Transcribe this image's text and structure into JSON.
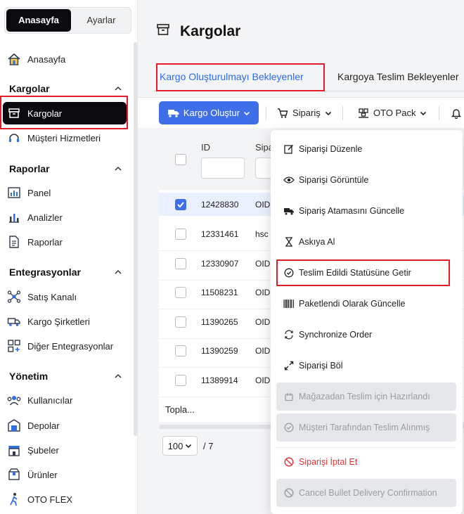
{
  "sidebar": {
    "toggle": {
      "active": "Anasayfa",
      "inactive": "Ayarlar"
    },
    "home": {
      "label": "Anasayfa"
    },
    "sections": [
      {
        "title": "Kargolar",
        "items": [
          {
            "label": "Kargolar"
          },
          {
            "label": "Müşteri Hizmetleri"
          }
        ]
      },
      {
        "title": "Raporlar",
        "items": [
          {
            "label": "Panel"
          },
          {
            "label": "Analizler"
          },
          {
            "label": "Raporlar"
          }
        ]
      },
      {
        "title": "Entegrasyonlar",
        "items": [
          {
            "label": "Satış Kanalı"
          },
          {
            "label": "Kargo Şirketleri"
          },
          {
            "label": "Diğer Entegrasyonlar"
          }
        ]
      },
      {
        "title": "Yönetim",
        "items": [
          {
            "label": "Kullanıcılar"
          },
          {
            "label": "Depolar"
          },
          {
            "label": "Şubeler"
          },
          {
            "label": "Ürünler"
          },
          {
            "label": "OTO FLEX"
          }
        ]
      }
    ]
  },
  "main": {
    "title": "Kargolar",
    "tabs": [
      {
        "label": "Kargo Oluşturulmayı Bekleyenler"
      },
      {
        "label": "Kargoya Teslim Bekleyenler"
      }
    ],
    "toolbar": {
      "create_label": "Kargo Oluştur",
      "order_label": "Sipariş",
      "pack_label": "OTO Pack"
    },
    "table": {
      "col_id": "ID",
      "col_order": "Sipa",
      "rows": [
        {
          "id": "12428830",
          "oid": "OID",
          "checked": true
        },
        {
          "id": "12331461",
          "oid": "hsc",
          "checked": false
        },
        {
          "id": "12330907",
          "oid": "OID",
          "checked": false
        },
        {
          "id": "11508231",
          "oid": "OID",
          "checked": false
        },
        {
          "id": "11390265",
          "oid": "OID",
          "checked": false
        },
        {
          "id": "11390259",
          "oid": "OID",
          "checked": false
        },
        {
          "id": "11389914",
          "oid": "OID",
          "checked": false
        }
      ],
      "footer": "Topla..."
    },
    "pager": {
      "page_size": "100",
      "total_pages": "/ 7"
    }
  },
  "dropdown": {
    "items": [
      {
        "label": "Siparişi Düzenle",
        "icon": "edit-icon"
      },
      {
        "label": "Siparişi Görüntüle",
        "icon": "eye-icon"
      },
      {
        "label": "Sipariş Atamasını Güncelle",
        "icon": "truck-icon"
      },
      {
        "label": "Askıya Al",
        "icon": "hourglass-icon"
      },
      {
        "label": "Teslim Edildi Statüsüne Getir",
        "icon": "check-circle-icon"
      },
      {
        "label": "Paketlendi Olarak Güncelle",
        "icon": "barcode-icon"
      },
      {
        "label": "Synchronize Order",
        "icon": "sync-icon"
      },
      {
        "label": "Siparişi Böl",
        "icon": "split-icon"
      },
      {
        "label": "Mağazadan Teslim için Hazırlandı",
        "icon": "store-icon"
      },
      {
        "label": "Müşteri Tarafından Teslim Alınmış",
        "icon": "check-circle-icon"
      },
      {
        "label": "Siparişi İptal Et",
        "icon": "cancel-icon"
      },
      {
        "label": "Cancel Bullet Delivery Confirmation",
        "icon": "cancel-icon"
      }
    ]
  },
  "colors": {
    "primary": "#3f6fe8",
    "highlight_box": "#e11d2a",
    "active_nav": "#0b0b0f",
    "danger": "#e5333b"
  }
}
